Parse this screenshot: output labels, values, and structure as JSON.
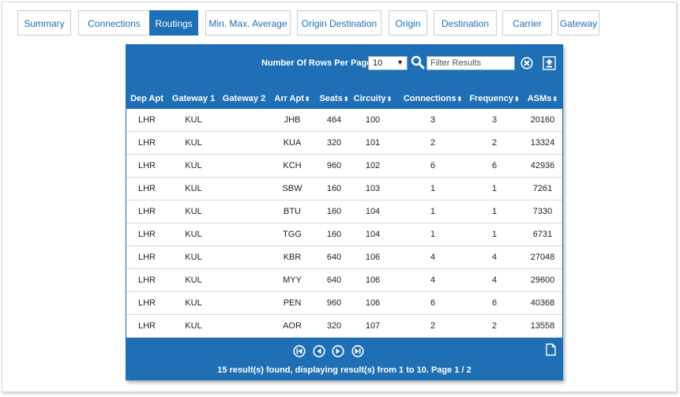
{
  "tabs": [
    {
      "label": "Summary",
      "active": false
    },
    {
      "label": "Connections",
      "active": false
    },
    {
      "label": "Routings",
      "active": true
    },
    {
      "label": "Min. Max. Average",
      "active": false
    },
    {
      "label": "Origin Destination",
      "active": false
    },
    {
      "label": "Origin",
      "active": false
    },
    {
      "label": "Destination",
      "active": false
    },
    {
      "label": "Carrier",
      "active": false
    },
    {
      "label": "Gateway",
      "active": false
    }
  ],
  "toolbar": {
    "rows_label": "Number Of Rows Per Page",
    "rows_value": "10",
    "filter_placeholder": "Filter Results",
    "search_icon": "search-icon",
    "clear_icon": "clear-icon",
    "export_icon": "export-icon"
  },
  "table": {
    "columns": [
      "Dep Apt",
      "Gateway 1",
      "Gateway 2",
      "Arr Apt",
      "Seats",
      "Circuity",
      "Connections",
      "Frequency",
      "ASMs"
    ],
    "sortable": [
      false,
      false,
      false,
      true,
      true,
      true,
      true,
      true,
      true
    ],
    "rows": [
      [
        "LHR",
        "KUL",
        "",
        "JHB",
        "464",
        "100",
        "3",
        "3",
        "20160"
      ],
      [
        "LHR",
        "KUL",
        "",
        "KUA",
        "320",
        "101",
        "2",
        "2",
        "13324"
      ],
      [
        "LHR",
        "KUL",
        "",
        "KCH",
        "960",
        "102",
        "6",
        "6",
        "42936"
      ],
      [
        "LHR",
        "KUL",
        "",
        "SBW",
        "160",
        "103",
        "1",
        "1",
        "7261"
      ],
      [
        "LHR",
        "KUL",
        "",
        "BTU",
        "160",
        "104",
        "1",
        "1",
        "7330"
      ],
      [
        "LHR",
        "KUL",
        "",
        "TGG",
        "160",
        "104",
        "1",
        "1",
        "6731"
      ],
      [
        "LHR",
        "KUL",
        "",
        "KBR",
        "640",
        "106",
        "4",
        "4",
        "27048"
      ],
      [
        "LHR",
        "KUL",
        "",
        "MYY",
        "640",
        "106",
        "4",
        "4",
        "29600"
      ],
      [
        "LHR",
        "KUL",
        "",
        "PEN",
        "960",
        "106",
        "6",
        "6",
        "40368"
      ],
      [
        "LHR",
        "KUL",
        "",
        "AOR",
        "320",
        "107",
        "2",
        "2",
        "13558"
      ]
    ]
  },
  "footer": {
    "status": "15 result(s) found, displaying result(s) from 1 to 10. Page 1 / 2",
    "pager_icons": [
      "first-page-icon",
      "previous-page-icon",
      "next-page-icon",
      "last-page-icon"
    ],
    "doc_icon": "document-icon"
  },
  "colors": {
    "accent": "#1e6fb5",
    "tab_text": "#1e6fb5",
    "row_border": "#d4d8dd"
  }
}
